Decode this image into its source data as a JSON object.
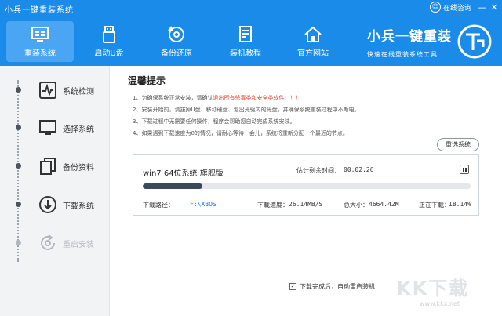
{
  "window": {
    "title": "小兵一键重装系统",
    "consult_label": "在线咨询",
    "consult_icon": "chat-icon"
  },
  "topnav": {
    "items": [
      {
        "label": "重装系统",
        "icon": "monitor-icon",
        "active": true
      },
      {
        "label": "启动U盘",
        "icon": "usb-icon",
        "active": false
      },
      {
        "label": "备份还原",
        "icon": "disc-restore-icon",
        "active": false
      },
      {
        "label": "装机教程",
        "icon": "document-icon",
        "active": false
      },
      {
        "label": "官方网站",
        "icon": "home-icon",
        "active": false
      }
    ],
    "brand_name": "小兵一键重装",
    "brand_slogan": "快速在线重装系统工具"
  },
  "sidebar": {
    "steps": [
      {
        "label": "系统检测",
        "icon": "pulse-icon",
        "state": "done"
      },
      {
        "label": "选择系统",
        "icon": "monitor-icon",
        "state": "done"
      },
      {
        "label": "备份资料",
        "icon": "copy-icon",
        "state": "done"
      },
      {
        "label": "下载系统",
        "icon": "download-icon",
        "state": "current"
      },
      {
        "label": "重启安装",
        "icon": "restart-icon",
        "state": "pending"
      }
    ]
  },
  "tips": {
    "title": "温馨提示",
    "items": [
      {
        "prefix": "1、为确保系统正常安装，请确认",
        "warn": "退出所有杀毒类和安全类软件！！！",
        "suffix": ""
      },
      {
        "prefix": "2、安装开始前，请拔掉U盘、移动硬盘、退出光驱内的光盘，并确保系统重装过程中不断电。",
        "warn": "",
        "suffix": ""
      },
      {
        "prefix": "3、下载过程中无需要任何操作，程序会帮助您自动完成系统安装。",
        "warn": "",
        "suffix": ""
      },
      {
        "prefix": "4、如果遇到下载速度为0的情况，请耐心等待一会儿，系统将重新分配一个最近的节点。",
        "warn": "",
        "suffix": ""
      }
    ]
  },
  "reselect_label": "重选系统",
  "download": {
    "name": "win7 64位系统 旗舰版",
    "eta_label": "估计剩余时间：",
    "eta": "00:02:26",
    "progress": 0.1814,
    "path_label": "下载路径：",
    "path": "F:\\XBOS",
    "speed_label": "下载速度：",
    "speed": "26.14MB/S",
    "size_label": "总大小：",
    "size": "4664.42M",
    "status_label": "正在下载：",
    "percent": "18.14%"
  },
  "autoreboot": {
    "checked": true,
    "label": "下载完成后，自动重启装机"
  },
  "watermark": {
    "logo": "KK下载",
    "url": "www.kkx.net"
  },
  "colors": {
    "header": "#1a8be8",
    "active_tab": "#4aa5f2",
    "warning": "#e8391f",
    "progress_fill": "#3a4a5c"
  }
}
